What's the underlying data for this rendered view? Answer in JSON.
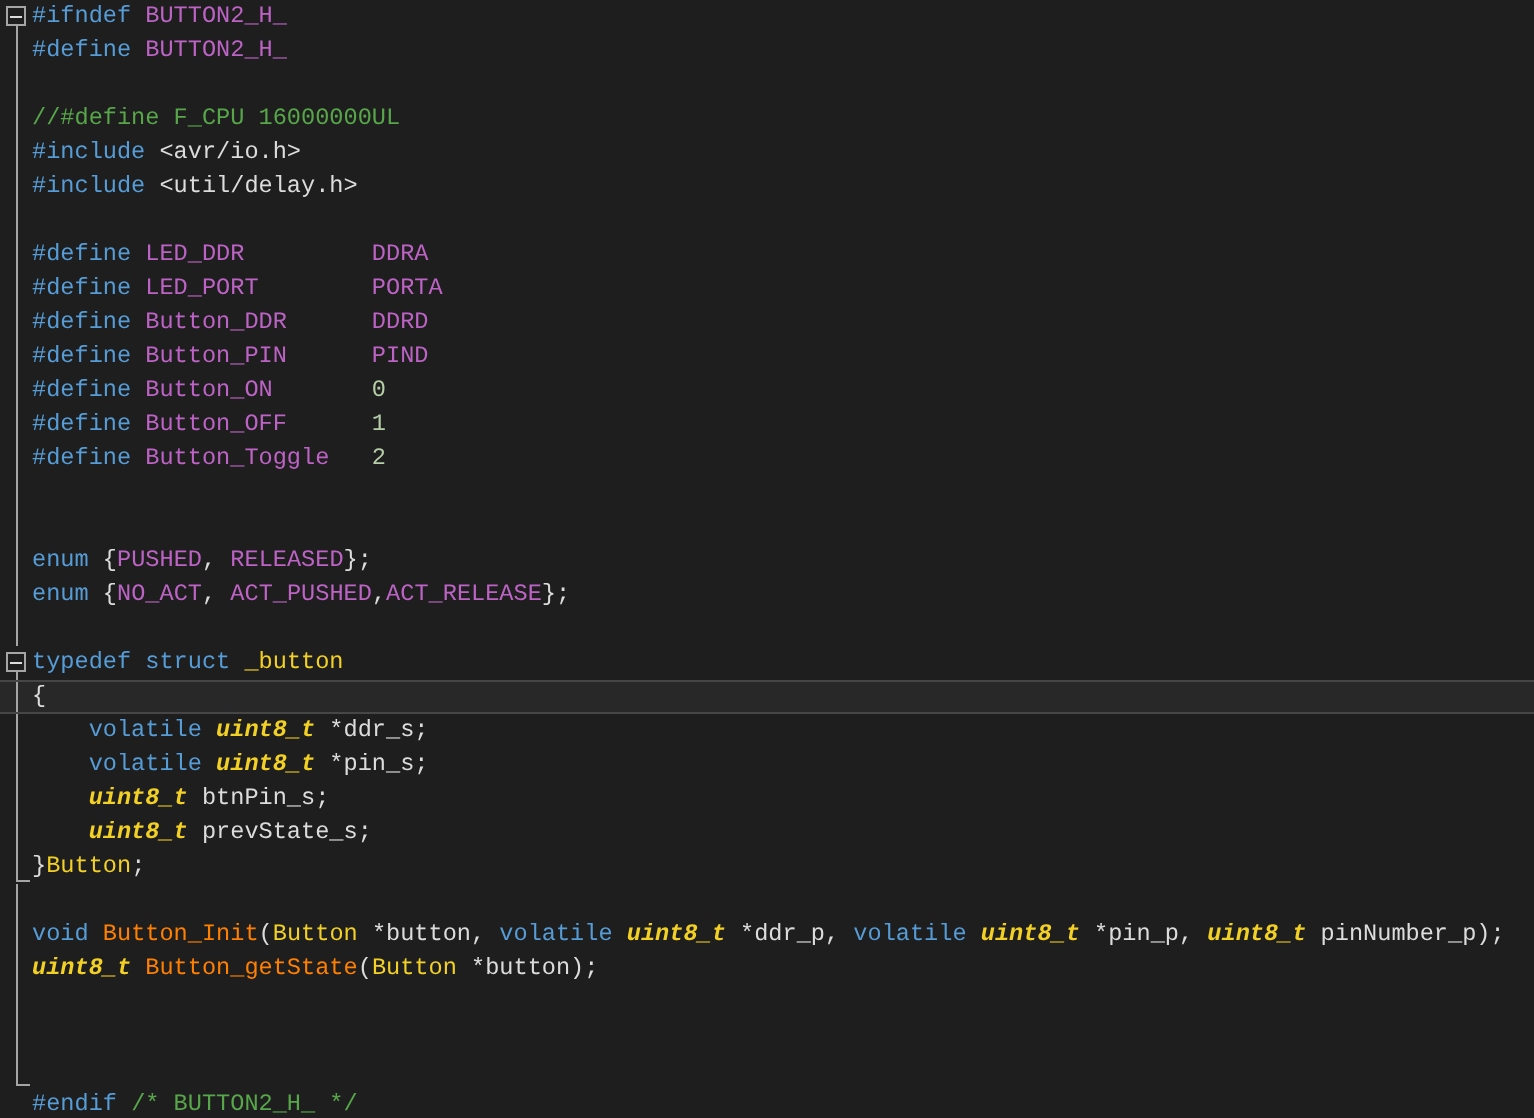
{
  "editor": {
    "lines": [
      {
        "fold": true,
        "guide": true,
        "guide_end": false,
        "current": false,
        "tokens": [
          {
            "kind": "keyword",
            "text": "#ifndef "
          },
          {
            "kind": "macro",
            "text": "BUTTON2_H_"
          }
        ]
      },
      {
        "fold": false,
        "guide": true,
        "guide_end": false,
        "current": false,
        "tokens": [
          {
            "kind": "keyword",
            "text": "#define "
          },
          {
            "kind": "macro",
            "text": "BUTTON2_H_"
          }
        ]
      },
      {
        "fold": false,
        "guide": true,
        "guide_end": false,
        "current": false
      },
      {
        "fold": false,
        "guide": true,
        "guide_end": false,
        "current": false,
        "tokens": [
          {
            "kind": "comment",
            "text": "//#define F_CPU 16000000UL"
          }
        ]
      },
      {
        "fold": false,
        "guide": true,
        "guide_end": false,
        "current": false,
        "tokens": [
          {
            "kind": "keyword",
            "text": "#include "
          },
          {
            "kind": "plain",
            "text": "<avr/io.h>"
          }
        ]
      },
      {
        "fold": false,
        "guide": true,
        "guide_end": false,
        "current": false,
        "tokens": [
          {
            "kind": "keyword",
            "text": "#include "
          },
          {
            "kind": "plain",
            "text": "<util/delay.h>"
          }
        ]
      },
      {
        "fold": false,
        "guide": true,
        "guide_end": false,
        "current": false
      },
      {
        "fold": false,
        "guide": true,
        "guide_end": false,
        "current": false,
        "tokens": [
          {
            "kind": "keyword",
            "text": "#define "
          },
          {
            "kind": "macro",
            "text": "LED_DDR         DDRA"
          }
        ]
      },
      {
        "fold": false,
        "guide": true,
        "guide_end": false,
        "current": false,
        "tokens": [
          {
            "kind": "keyword",
            "text": "#define "
          },
          {
            "kind": "macro",
            "text": "LED_PORT        PORTA"
          }
        ]
      },
      {
        "fold": false,
        "guide": true,
        "guide_end": false,
        "current": false,
        "tokens": [
          {
            "kind": "keyword",
            "text": "#define "
          },
          {
            "kind": "macro",
            "text": "Button_DDR      DDRD"
          }
        ]
      },
      {
        "fold": false,
        "guide": true,
        "guide_end": false,
        "current": false,
        "tokens": [
          {
            "kind": "keyword",
            "text": "#define "
          },
          {
            "kind": "macro",
            "text": "Button_PIN      PIND"
          }
        ]
      },
      {
        "fold": false,
        "guide": true,
        "guide_end": false,
        "current": false,
        "tokens": [
          {
            "kind": "keyword",
            "text": "#define "
          },
          {
            "kind": "macro",
            "text": "Button_ON       "
          },
          {
            "kind": "number",
            "text": "0"
          }
        ]
      },
      {
        "fold": false,
        "guide": true,
        "guide_end": false,
        "current": false,
        "tokens": [
          {
            "kind": "keyword",
            "text": "#define "
          },
          {
            "kind": "macro",
            "text": "Button_OFF      "
          },
          {
            "kind": "number",
            "text": "1"
          }
        ]
      },
      {
        "fold": false,
        "guide": true,
        "guide_end": false,
        "current": false,
        "tokens": [
          {
            "kind": "keyword",
            "text": "#define "
          },
          {
            "kind": "macro",
            "text": "Button_Toggle   "
          },
          {
            "kind": "number",
            "text": "2"
          }
        ]
      },
      {
        "fold": false,
        "guide": true,
        "guide_end": false,
        "current": false
      },
      {
        "fold": false,
        "guide": true,
        "guide_end": false,
        "current": false
      },
      {
        "fold": false,
        "guide": true,
        "guide_end": false,
        "current": false,
        "tokens": [
          {
            "kind": "keyword",
            "text": "enum "
          },
          {
            "kind": "plain",
            "text": "{"
          },
          {
            "kind": "macro",
            "text": "PUSHED"
          },
          {
            "kind": "plain",
            "text": ", "
          },
          {
            "kind": "macro",
            "text": "RELEASED"
          },
          {
            "kind": "plain",
            "text": "};"
          }
        ]
      },
      {
        "fold": false,
        "guide": true,
        "guide_end": false,
        "current": false,
        "tokens": [
          {
            "kind": "keyword",
            "text": "enum "
          },
          {
            "kind": "plain",
            "text": "{"
          },
          {
            "kind": "macro",
            "text": "NO_ACT"
          },
          {
            "kind": "plain",
            "text": ", "
          },
          {
            "kind": "macro",
            "text": "ACT_PUSHED"
          },
          {
            "kind": "plain",
            "text": ","
          },
          {
            "kind": "macro",
            "text": "ACT_RELEASE"
          },
          {
            "kind": "plain",
            "text": "};"
          }
        ]
      },
      {
        "fold": false,
        "guide": true,
        "guide_end": false,
        "current": false
      },
      {
        "fold": true,
        "guide": true,
        "guide_end": false,
        "current": false,
        "tokens": [
          {
            "kind": "keyword",
            "text": "typedef struct "
          },
          {
            "kind": "struct",
            "text": "_button"
          }
        ]
      },
      {
        "fold": false,
        "guide": true,
        "guide_end": false,
        "current": true,
        "tokens": [
          {
            "kind": "plain",
            "text": "{"
          }
        ]
      },
      {
        "fold": false,
        "guide": true,
        "guide_end": false,
        "current": false,
        "tokens": [
          {
            "kind": "keyword",
            "text": "    volatile "
          },
          {
            "kind": "type",
            "text": "uint8_t"
          },
          {
            "kind": "plain",
            "text": " *ddr_s;"
          }
        ]
      },
      {
        "fold": false,
        "guide": true,
        "guide_end": false,
        "current": false,
        "tokens": [
          {
            "kind": "keyword",
            "text": "    volatile "
          },
          {
            "kind": "type",
            "text": "uint8_t"
          },
          {
            "kind": "plain",
            "text": " *pin_s;"
          }
        ]
      },
      {
        "fold": false,
        "guide": true,
        "guide_end": false,
        "current": false,
        "tokens": [
          {
            "kind": "type",
            "text": "    uint8_t"
          },
          {
            "kind": "plain",
            "text": " btnPin_s;"
          }
        ]
      },
      {
        "fold": false,
        "guide": true,
        "guide_end": false,
        "current": false,
        "tokens": [
          {
            "kind": "type",
            "text": "    uint8_t"
          },
          {
            "kind": "plain",
            "text": " prevState_s;"
          }
        ]
      },
      {
        "fold": false,
        "guide": true,
        "guide_end": true,
        "current": false,
        "tokens": [
          {
            "kind": "plain",
            "text": "}"
          },
          {
            "kind": "struct",
            "text": "Button"
          },
          {
            "kind": "plain",
            "text": ";"
          }
        ]
      },
      {
        "fold": false,
        "guide": true,
        "guide_end": false,
        "current": false
      },
      {
        "fold": false,
        "guide": true,
        "guide_end": false,
        "current": false,
        "tokens": [
          {
            "kind": "keyword",
            "text": "void "
          },
          {
            "kind": "func",
            "text": "Button_Init"
          },
          {
            "kind": "plain",
            "text": "("
          },
          {
            "kind": "struct",
            "text": "Button"
          },
          {
            "kind": "plain",
            "text": " *button, "
          },
          {
            "kind": "keyword",
            "text": "volatile "
          },
          {
            "kind": "type",
            "text": "uint8_t"
          },
          {
            "kind": "plain",
            "text": " *ddr_p, "
          },
          {
            "kind": "keyword",
            "text": "volatile "
          },
          {
            "kind": "type",
            "text": "uint8_t"
          },
          {
            "kind": "plain",
            "text": " *pin_p, "
          },
          {
            "kind": "type",
            "text": "uint8_t"
          },
          {
            "kind": "plain",
            "text": " pinNumber_p);"
          }
        ]
      },
      {
        "fold": false,
        "guide": true,
        "guide_end": false,
        "current": false,
        "tokens": [
          {
            "kind": "type",
            "text": "uint8_t "
          },
          {
            "kind": "func",
            "text": "Button_getState"
          },
          {
            "kind": "plain",
            "text": "("
          },
          {
            "kind": "struct",
            "text": "Button"
          },
          {
            "kind": "plain",
            "text": " *button);"
          }
        ]
      },
      {
        "fold": false,
        "guide": true,
        "guide_end": false,
        "current": false
      },
      {
        "fold": false,
        "guide": true,
        "guide_end": false,
        "current": false
      },
      {
        "fold": false,
        "guide": true,
        "guide_end": true,
        "current": false
      },
      {
        "fold": false,
        "guide": false,
        "guide_end": false,
        "current": false,
        "tokens": [
          {
            "kind": "keyword",
            "text": "#endif "
          },
          {
            "kind": "comment",
            "text": "/* BUTTON2_H_ */"
          }
        ]
      }
    ]
  }
}
